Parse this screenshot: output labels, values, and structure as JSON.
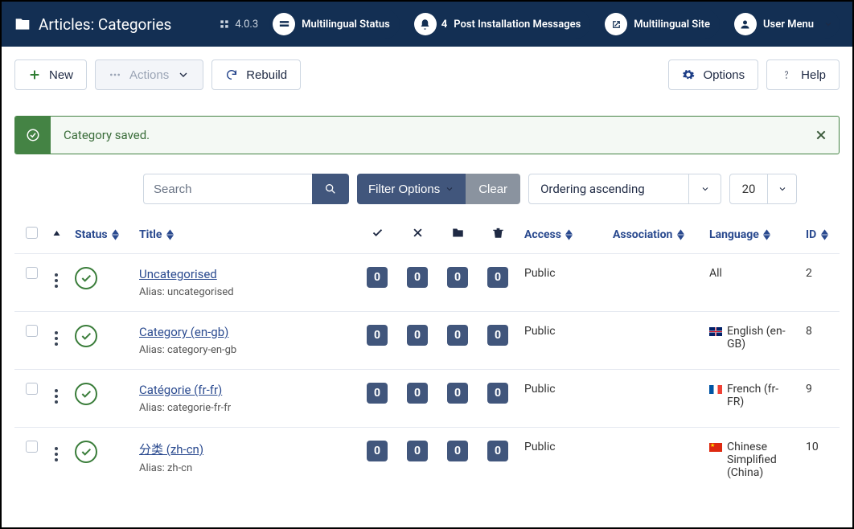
{
  "header": {
    "title": "Articles: Categories",
    "version": "4.0.3",
    "nav": {
      "multilingual_status": "Multilingual Status",
      "notification_count": "4",
      "post_install": "Post Installation Messages",
      "multilingual_site": "Multilingual Site",
      "user_menu": "User Menu"
    }
  },
  "toolbar": {
    "new": "New",
    "actions": "Actions",
    "rebuild": "Rebuild",
    "options": "Options",
    "help": "Help"
  },
  "alert": {
    "message": "Category saved."
  },
  "search": {
    "placeholder": "Search",
    "filter_label": "Filter Options",
    "clear_label": "Clear",
    "ordering": "Ordering ascending",
    "limit": "20"
  },
  "columns": {
    "status": "Status",
    "title": "Title",
    "access": "Access",
    "association": "Association",
    "language": "Language",
    "id": "ID"
  },
  "alias_prefix": "Alias: ",
  "rows": [
    {
      "title": "Uncategorised",
      "alias": "uncategorised",
      "counts": [
        "0",
        "0",
        "0",
        "0"
      ],
      "access": "Public",
      "language": "All",
      "flag": "",
      "id": "2"
    },
    {
      "title": "Category (en-gb)",
      "alias": "category-en-gb",
      "counts": [
        "0",
        "0",
        "0",
        "0"
      ],
      "access": "Public",
      "language": "English (en-GB)",
      "flag": "gb",
      "id": "8"
    },
    {
      "title": "Catégorie (fr-fr)",
      "alias": "categorie-fr-fr",
      "counts": [
        "0",
        "0",
        "0",
        "0"
      ],
      "access": "Public",
      "language": "French (fr-FR)",
      "flag": "fr",
      "id": "9"
    },
    {
      "title": "分类 (zh-cn)",
      "alias": "zh-cn",
      "counts": [
        "0",
        "0",
        "0",
        "0"
      ],
      "access": "Public",
      "language": "Chinese Simplified (China)",
      "flag": "cn",
      "id": "10"
    }
  ]
}
